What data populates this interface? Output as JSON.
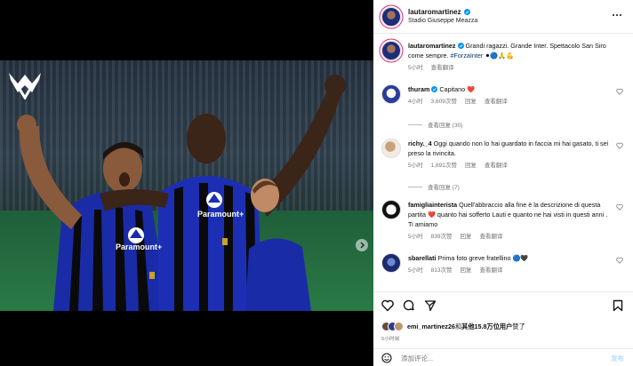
{
  "post": {
    "username": "lautaromartinez",
    "location": "Stadio Giuseppe Meazza",
    "caption": {
      "username": "lautaromartinez",
      "text": "Grandi ragazzi. Grande Inter. Spettacolo San Siro come sempre.",
      "hashtag": "#ForzaInter",
      "emoji": "⚫🔵🙏💪",
      "time": "5小时",
      "translate": "查看翻译"
    },
    "more_icon": "more-horizontal-icon",
    "accent_color": "#0095f6"
  },
  "image": {
    "jersey_sponsor": "Paramount+"
  },
  "comments": [
    {
      "username": "thuram",
      "verified": true,
      "text": "Capitano",
      "emoji": "❤️",
      "time": "4小时",
      "likes": "3,609次赞",
      "reply": "回复",
      "translate": "查看翻译",
      "view_replies": "查看回复 (30)"
    },
    {
      "username": "richy._4",
      "verified": false,
      "text": "Oggi quando non lo hai guardato in faccia mi hai gasato, ti sei preso la rivincita.",
      "time": "5小时",
      "likes": "1,691次赞",
      "reply": "回复",
      "translate": "查看翻译",
      "view_replies": "查看回复 (7)"
    },
    {
      "username": "famigliainterista",
      "verified": false,
      "text": "Quell'abbraccio alla fine è la descrizione di questa partita ❤️ quanto hai sofferto Lauti e quanto ne hai visti in questi anni . Ti amiamo",
      "time": "5小时",
      "likes": "839次赞",
      "reply": "回复",
      "translate": "查看翻译"
    },
    {
      "username": "sbarellati",
      "verified": false,
      "text": "Prima foto greve fratellino 🔵🖤",
      "time": "5小时",
      "likes": "813次赞",
      "reply": "回复",
      "translate": "查看翻译"
    }
  ],
  "actions": {
    "like_icon": "heart-icon",
    "comment_icon": "comment-icon",
    "share_icon": "share-icon",
    "save_icon": "bookmark-icon"
  },
  "likes": {
    "liked_by": "emi_martinez26",
    "and_others": "和",
    "others_count": "其他15.8万位用户",
    "suffix": "赞了"
  },
  "time_ago": "5小时前",
  "add_comment": {
    "placeholder": "添加评论...",
    "post_label": "发布",
    "emoji_icon": "smiley-icon"
  }
}
